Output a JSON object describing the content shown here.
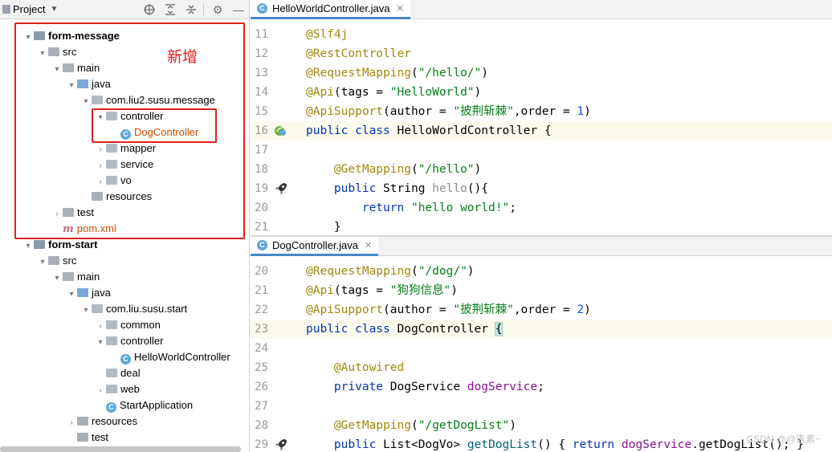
{
  "project": {
    "title": "Project",
    "icons": [
      "target-icon",
      "expand-icon",
      "collapse-icon",
      "gear-icon",
      "minimize-icon"
    ],
    "tree": [
      {
        "label": "form-message",
        "depth": 0,
        "arrow": "▾",
        "kind": "mod",
        "bold": true
      },
      {
        "label": "src",
        "depth": 1,
        "arrow": "▾",
        "kind": "gray"
      },
      {
        "label": "main",
        "depth": 2,
        "arrow": "▾",
        "kind": "gray"
      },
      {
        "label": "java",
        "depth": 3,
        "arrow": "▾",
        "kind": "blue"
      },
      {
        "label": "com.liu2.susu.message",
        "depth": 4,
        "arrow": "▾",
        "kind": "pkg"
      },
      {
        "label": "controller",
        "depth": 5,
        "arrow": "▾",
        "kind": "pkg"
      },
      {
        "label": "DogController",
        "depth": 6,
        "arrow": "",
        "kind": "class",
        "color": "#c74f00"
      },
      {
        "label": "mapper",
        "depth": 5,
        "arrow": "›",
        "kind": "pkg"
      },
      {
        "label": "service",
        "depth": 5,
        "arrow": "›",
        "kind": "pkg"
      },
      {
        "label": "vo",
        "depth": 5,
        "arrow": "›",
        "kind": "pkg"
      },
      {
        "label": "resources",
        "depth": 4,
        "arrow": "",
        "kind": "gray"
      },
      {
        "label": "test",
        "depth": 2,
        "arrow": "›",
        "kind": "gray"
      },
      {
        "label": "pom.xml",
        "depth": 2,
        "arrow": "",
        "kind": "maven",
        "color": "#c74f00"
      },
      {
        "label": "form-start",
        "depth": 0,
        "arrow": "▾",
        "kind": "mod",
        "bold": true
      },
      {
        "label": "src",
        "depth": 1,
        "arrow": "▾",
        "kind": "gray"
      },
      {
        "label": "main",
        "depth": 2,
        "arrow": "▾",
        "kind": "gray"
      },
      {
        "label": "java",
        "depth": 3,
        "arrow": "▾",
        "kind": "blue"
      },
      {
        "label": "com.liu.susu.start",
        "depth": 4,
        "arrow": "▾",
        "kind": "pkg"
      },
      {
        "label": "common",
        "depth": 5,
        "arrow": "›",
        "kind": "pkg"
      },
      {
        "label": "controller",
        "depth": 5,
        "arrow": "▾",
        "kind": "pkg"
      },
      {
        "label": "HelloWorldController",
        "depth": 6,
        "arrow": "",
        "kind": "class"
      },
      {
        "label": "deal",
        "depth": 5,
        "arrow": "",
        "kind": "pkg"
      },
      {
        "label": "web",
        "depth": 5,
        "arrow": "›",
        "kind": "pkg"
      },
      {
        "label": "StartApplication",
        "depth": 5,
        "arrow": "",
        "kind": "class"
      },
      {
        "label": "resources",
        "depth": 3,
        "arrow": "›",
        "kind": "gray"
      },
      {
        "label": "test",
        "depth": 3,
        "arrow": "",
        "kind": "gray"
      }
    ],
    "annotation": "新增"
  },
  "editor1": {
    "tab": "HelloWorldController.java",
    "lines": [
      {
        "n": "11",
        "html": "<span class='ann'>@Slf4j</span>"
      },
      {
        "n": "12",
        "html": "<span class='ann'>@RestController</span>"
      },
      {
        "n": "13",
        "html": "<span class='ann'>@RequestMapping</span>(<span class='str'>\"/hello/\"</span>)"
      },
      {
        "n": "14",
        "html": "<span class='ann'>@Api</span>(tags = <span class='str'>\"HelloWorld\"</span>)"
      },
      {
        "n": "15",
        "html": "<span class='ann'>@ApiSupport</span>(author = <span class='str'>\"披荆斩棘\"</span>,order = <span class='num'>1</span>)"
      },
      {
        "n": "16",
        "html": "<span class='kw'>public class</span> HelloWorldController {",
        "cur": true,
        "gicon": "bean"
      },
      {
        "n": "17",
        "html": ""
      },
      {
        "n": "18",
        "html": "    <span class='ann'>@GetMapping</span>(<span class='str'>\"/hello\"</span>)"
      },
      {
        "n": "19",
        "html": "    <span class='kw'>public</span> String <span class='gray'>hello</span>(){",
        "gicon": "rocket"
      },
      {
        "n": "20",
        "html": "        <span class='kw'>return</span> <span class='str'>\"hello world!\"</span>;"
      },
      {
        "n": "21",
        "html": "    }"
      }
    ]
  },
  "editor2": {
    "tab": "DogController.java",
    "lines": [
      {
        "n": "20",
        "html": "<span class='ann'>@RequestMapping</span>(<span class='str'>\"/dog/\"</span>)"
      },
      {
        "n": "21",
        "html": "<span class='ann'>@Api</span>(tags = <span class='str'>\"狗狗信息\"</span>)"
      },
      {
        "n": "22",
        "html": "<span class='ann'>@ApiSupport</span>(author = <span class='str'>\"披荆斩棘\"</span>,order = <span class='num'>2</span>)"
      },
      {
        "n": "23",
        "html": "<span class='kw'>public class</span> DogController <span class='bracehl'>{</span>",
        "cur": true
      },
      {
        "n": "24",
        "html": ""
      },
      {
        "n": "25",
        "html": "    <span class='ann'>@Autowired</span>"
      },
      {
        "n": "26",
        "html": "    <span class='kw'>private</span> DogService <span class='fld'>dogService</span>;"
      },
      {
        "n": "27",
        "html": ""
      },
      {
        "n": "28",
        "html": "    <span class='ann'>@GetMapping</span>(<span class='str'>\"/getDogList\"</span>)"
      },
      {
        "n": "29",
        "html": "    <span class='kw'>public</span> List&lt;DogVo&gt; <span class='mth'>getDogList</span>() { <span class='kw'>return</span> <span class='fld'>dogService</span>.getDogList(); }",
        "gicon": "rocket"
      }
    ]
  },
  "watermark": "CSDN @@素素~"
}
